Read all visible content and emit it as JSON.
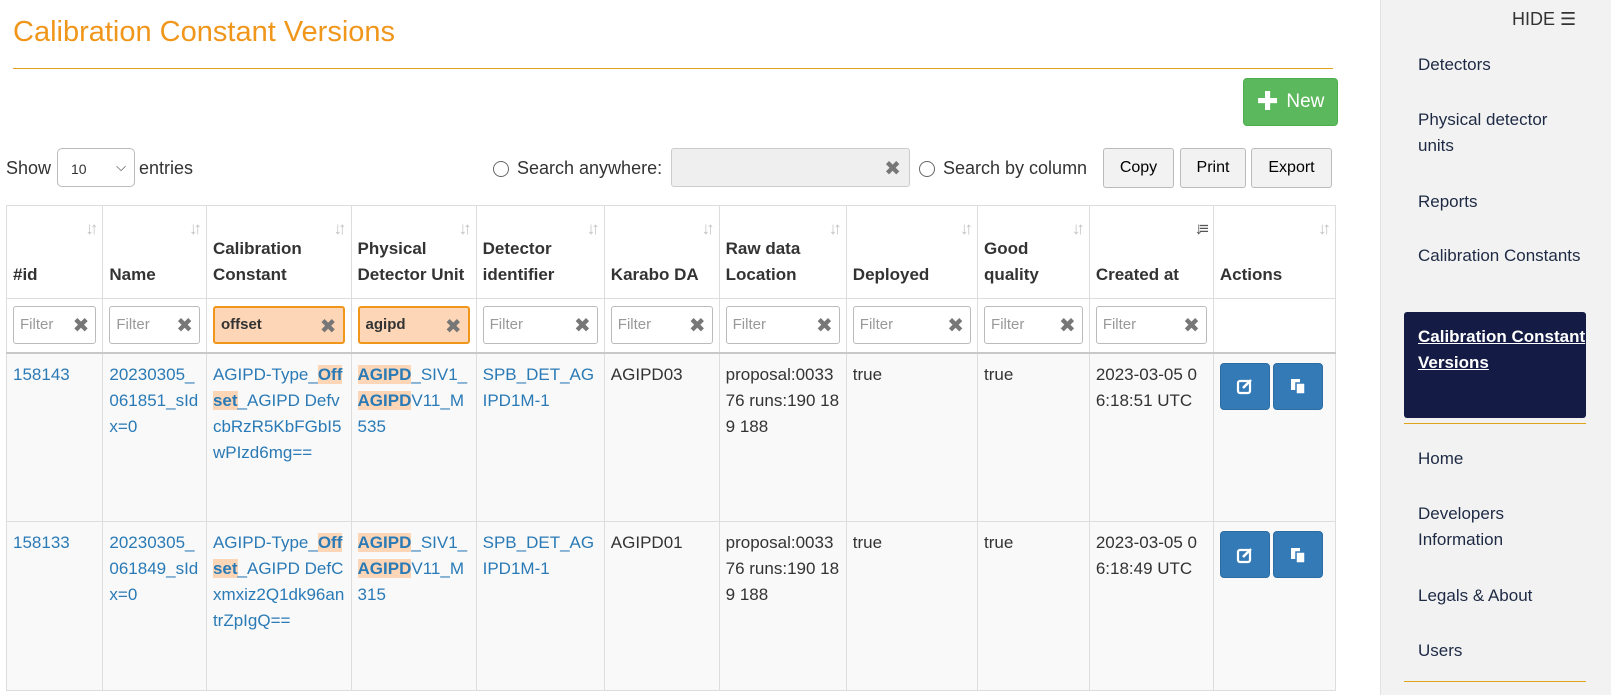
{
  "page": {
    "title": "Calibration Constant Versions"
  },
  "toolbar": {
    "new_label": "New"
  },
  "controls": {
    "show_label": "Show",
    "length_value": "10",
    "entries_label": "entries",
    "search_anywhere_label": "Search anywhere:",
    "search_by_column_label": "Search by column",
    "copy_label": "Copy",
    "print_label": "Print",
    "export_label": "Export"
  },
  "table": {
    "headers": [
      "#id",
      "Name",
      "Calibration Constant",
      "Physical Detector Unit",
      "Detector identifier",
      "Karabo DA",
      "Raw data Location",
      "Deployed",
      "Good quality",
      "Created at",
      "Actions"
    ],
    "filter_placeholder": "Filter",
    "filters": {
      "calibration_constant": "offset",
      "physical_detector_unit": "agipd"
    },
    "rows": [
      {
        "id": "158143",
        "name": "20230305_061851_sIdx=0",
        "cc_pre": "AGIPD-Type_",
        "cc_hl": "Offset",
        "cc_post": "_AGIPD DefvcbRzR5KbFGbI5wPIzd6mg==",
        "pdu_hl1": "AGIPD",
        "pdu_mid": "_SIV1_",
        "pdu_hl2": "AGIPD",
        "pdu_post": "V11_M535",
        "detector": "SPB_DET_AGIPD1M-1",
        "karabo_da": "AGIPD03",
        "raw_location": "proposal:003376 runs:190 189 188",
        "deployed": "true",
        "good_quality": "true",
        "created_at": "2023-03-05 06:18:51 UTC"
      },
      {
        "id": "158133",
        "name": "20230305_061849_sIdx=0",
        "cc_pre": "AGIPD-Type_",
        "cc_hl": "Offset",
        "cc_post": "_AGIPD DefCxmxiz2Q1dk96antrZpIgQ==",
        "pdu_hl1": "AGIPD",
        "pdu_mid": "_SIV1_",
        "pdu_hl2": "AGIPD",
        "pdu_post": "V11_M315",
        "detector": "SPB_DET_AGIPD1M-1",
        "karabo_da": "AGIPD01",
        "raw_location": "proposal:003376 runs:190 189 188",
        "deployed": "true",
        "good_quality": "true",
        "created_at": "2023-03-05 06:18:49 UTC"
      }
    ]
  },
  "sidebar": {
    "hide_label": "HIDE",
    "items": [
      "Detectors",
      "Physical detector units",
      "Reports",
      "Calibration Constants",
      "Calibration Constant Versions",
      "Home",
      "Developers Information",
      "Legals & About",
      "Users"
    ],
    "active_index": 4
  },
  "colors": {
    "title": "#f0961b",
    "new_button": "#5cb85c",
    "action_button": "#337ab7",
    "active_nav": "#141c45",
    "highlight": "#fcd6b6"
  }
}
